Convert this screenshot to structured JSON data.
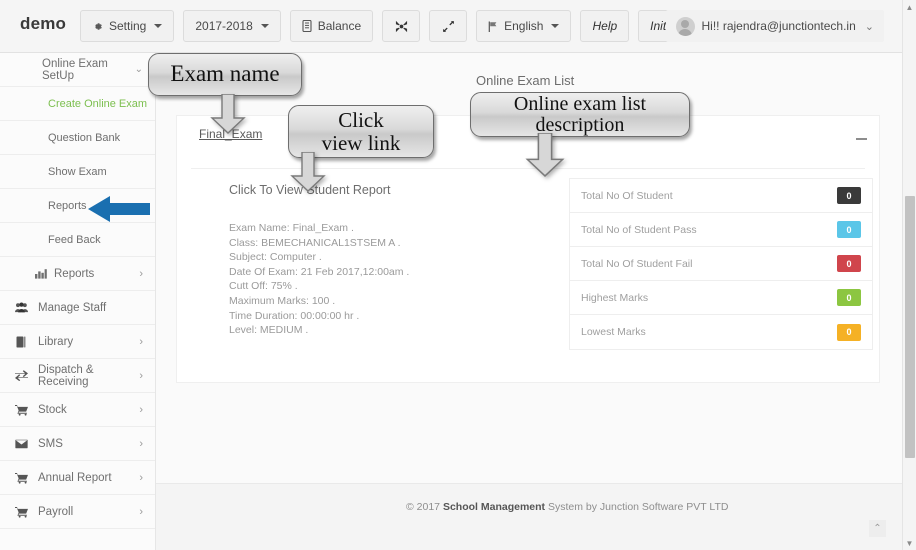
{
  "navbar": {
    "brand": "demo",
    "buttons": [
      {
        "label": "Setting",
        "icon": "gear-icon",
        "caret": true
      },
      {
        "label": "2017-2018",
        "icon": "",
        "caret": true
      },
      {
        "label": "Balance",
        "icon": "book-icon",
        "caret": false
      },
      {
        "label": "",
        "icon": "compress-icon",
        "caret": false
      },
      {
        "label": "",
        "icon": "expand-icon",
        "caret": false
      },
      {
        "label": "English",
        "icon": "flag-icon",
        "caret": true
      },
      {
        "label": "Help",
        "icon": "",
        "caret": false
      },
      {
        "label": "Initial setup",
        "icon": "",
        "caret": false
      }
    ],
    "user": {
      "greeting": "Hi!! rajendra@junctiontech.in",
      "caret": "⌄"
    }
  },
  "sidebar": {
    "items": [
      {
        "label": "Online Exam SetUp",
        "icon": "",
        "arrow": "⌄",
        "type": "head"
      },
      {
        "label": "Create Online Exam",
        "icon": "",
        "arrow": "",
        "type": "sub-active"
      },
      {
        "label": "Question Bank",
        "icon": "",
        "arrow": "",
        "type": "sub"
      },
      {
        "label": "Show Exam",
        "icon": "",
        "arrow": "",
        "type": "sub"
      },
      {
        "label": "Reports",
        "icon": "",
        "arrow": "",
        "type": "sub"
      },
      {
        "label": "Feed Back",
        "icon": "",
        "arrow": "",
        "type": "sub"
      },
      {
        "label": "Reports",
        "icon": "bar-chart-icon",
        "arrow": "›",
        "type": "head-icon"
      },
      {
        "label": "Manage Staff",
        "icon": "users-icon",
        "arrow": "",
        "type": "lvl0"
      },
      {
        "label": "Library",
        "icon": "book-icon",
        "arrow": "›",
        "type": "lvl0"
      },
      {
        "label": "Dispatch & Receiving",
        "icon": "exchange-icon",
        "arrow": "›",
        "type": "lvl0"
      },
      {
        "label": "Stock",
        "icon": "cart-icon",
        "arrow": "›",
        "type": "lvl0"
      },
      {
        "label": "SMS",
        "icon": "envelope-icon",
        "arrow": "›",
        "type": "lvl0"
      },
      {
        "label": "Annual Report",
        "icon": "cart-icon",
        "arrow": "›",
        "type": "lvl0"
      },
      {
        "label": "Payroll",
        "icon": "cart-icon",
        "arrow": "›",
        "type": "lvl0"
      }
    ]
  },
  "main": {
    "page_title": "Online Exam List",
    "tab_label": "Final_Exam",
    "report_link": "Click To View Student Report",
    "details": [
      "Exam Name: Final_Exam .",
      "Class: BEMECHANICAL1STSEM A .",
      "Subject: Computer .",
      "Date Of Exam: 21 Feb 2017,12:00am .",
      "Cutt Off: 75% .",
      "Maximum Marks: 100 .",
      "Time Duration: 00:00:00 hr .",
      "Level: MEDIUM ."
    ],
    "stats": [
      {
        "label": "Total No Of Student",
        "value": "0",
        "color": "#3a3a3a"
      },
      {
        "label": "Total No of Student Pass",
        "value": "0",
        "color": "#5bc6e8"
      },
      {
        "label": "Total No Of Student Fail",
        "value": "0",
        "color": "#d0454c"
      },
      {
        "label": "Highest Marks",
        "value": "0",
        "color": "#8cc641"
      },
      {
        "label": "Lowest Marks",
        "value": "0",
        "color": "#f5b125"
      }
    ]
  },
  "footer": {
    "copyright_prefix": "© 2017 ",
    "copyright_bold": "School Management",
    "copyright_suffix": " System by Junction Software PVT LTD",
    "back_to_top": "⌃"
  },
  "annotations": {
    "exam_name": "Exam name",
    "click_view": "Click\nview link",
    "list_description": "Online exam list\ndescription"
  },
  "colors": {
    "highlight_arrow": "#1a6fb0",
    "active_menu": "#7cbf4f",
    "badge_dark": "#3a3a3a",
    "badge_blue": "#5bc6e8",
    "badge_red": "#d0454c",
    "badge_green": "#8cc641",
    "badge_orange": "#f5b125"
  },
  "scrollbar": {
    "up": "▲",
    "down": "▼"
  }
}
